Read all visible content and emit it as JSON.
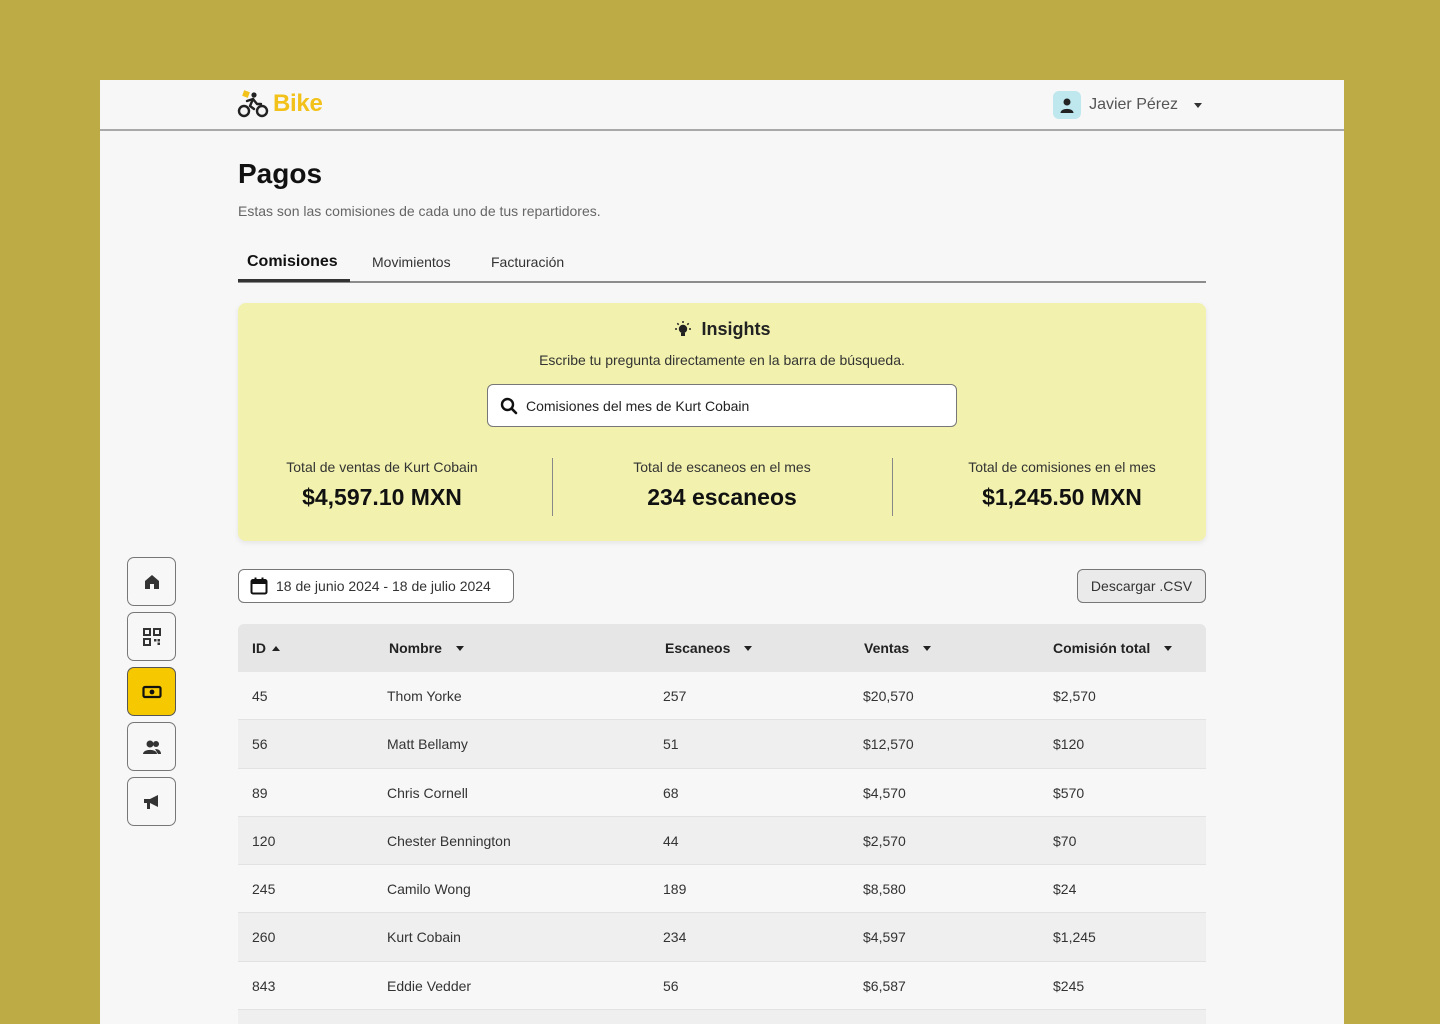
{
  "app": {
    "name": "Bike",
    "brand_color": "#F2C21B",
    "accent_color": "#F5C800"
  },
  "user": {
    "name": "Javier Pérez"
  },
  "page": {
    "title": "Pagos",
    "subtitle": "Estas son las comisiones de cada uno de tus repartidores."
  },
  "tabs": [
    {
      "label": "Comisiones",
      "active": true
    },
    {
      "label": "Movimientos",
      "active": false
    },
    {
      "label": "Facturación",
      "active": false
    }
  ],
  "insights": {
    "title": "Insights",
    "description": "Escribe tu pregunta directamente en la barra de búsqueda.",
    "search_value": "Comisiones del mes de Kurt Cobain",
    "stats": [
      {
        "label": "Total de ventas de Kurt Cobain",
        "value": "$4,597.10 MXN"
      },
      {
        "label": "Total de escaneos en el mes",
        "value": "234 escaneos"
      },
      {
        "label": "Total de comisiones en el mes",
        "value": "$1,245.50 MXN"
      }
    ]
  },
  "sidebar": [
    {
      "icon": "home-icon",
      "active": false
    },
    {
      "icon": "qr-code-icon",
      "active": false
    },
    {
      "icon": "money-icon",
      "active": true
    },
    {
      "icon": "users-icon",
      "active": false
    },
    {
      "icon": "megaphone-icon",
      "active": false
    }
  ],
  "toolbar": {
    "date_range": "18 de junio 2024 - 18 de julio 2024",
    "download_label": "Descargar .CSV"
  },
  "table": {
    "columns": [
      "ID",
      "Nombre",
      "Escaneos",
      "Ventas",
      "Comisión total"
    ],
    "rows": [
      [
        "45",
        "Thom Yorke",
        "257",
        "$20,570",
        "$2,570"
      ],
      [
        "56",
        "Matt Bellamy",
        "51",
        "$12,570",
        "$120"
      ],
      [
        "89",
        "Chris Cornell",
        "68",
        "$4,570",
        "$570"
      ],
      [
        "120",
        "Chester Bennington",
        "44",
        "$2,570",
        "$70"
      ],
      [
        "245",
        "Camilo Wong",
        "189",
        "$8,580",
        "$24"
      ],
      [
        "260",
        "Kurt Cobain",
        "234",
        "$4,597",
        "$1,245"
      ],
      [
        "843",
        "Eddie Vedder",
        "56",
        "$6,587",
        "$245"
      ]
    ]
  }
}
